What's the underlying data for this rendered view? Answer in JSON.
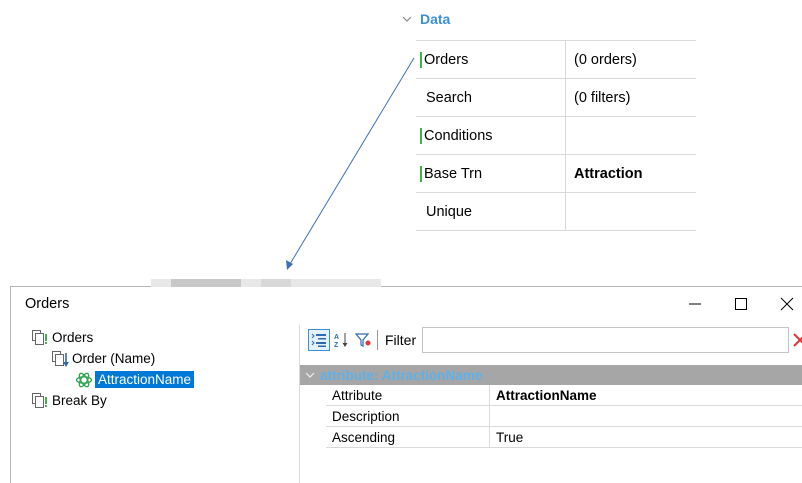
{
  "data_panel": {
    "section_title": "Data",
    "rows": [
      {
        "name": "Orders",
        "value": "(0 orders)",
        "marked": true,
        "bold": false
      },
      {
        "name": "Search",
        "value": "(0 filters)",
        "marked": false,
        "bold": false
      },
      {
        "name": "Conditions",
        "value": "",
        "marked": true,
        "bold": false
      },
      {
        "name": "Base Trn",
        "value": "Attraction",
        "marked": true,
        "bold": true
      },
      {
        "name": "Unique",
        "value": "",
        "marked": false,
        "bold": false
      }
    ]
  },
  "window": {
    "title": "Orders",
    "controls": {
      "minimize": "minimize-icon",
      "maximize": "maximize-icon",
      "close": "close-icon"
    }
  },
  "tree": {
    "root": "Orders",
    "order": "Order (Name)",
    "attribute": "AttractionName",
    "break_by": "Break By"
  },
  "toolbar": {
    "filter_label": "Filter",
    "filter_value": ""
  },
  "properties": {
    "section_title": "attribute: AttractionName",
    "rows": [
      {
        "name": "Attribute",
        "value": "AttractionName",
        "bold": true
      },
      {
        "name": "Description",
        "value": "",
        "bold": false
      },
      {
        "name": "Ascending",
        "value": "True",
        "bold": false
      }
    ]
  },
  "colors": {
    "accent_blue": "#3a8fd6",
    "selection": "#0078d7",
    "marker_green": "#3cb44b",
    "section_bg": "#a6a6a6",
    "close_red": "#e0353b"
  }
}
